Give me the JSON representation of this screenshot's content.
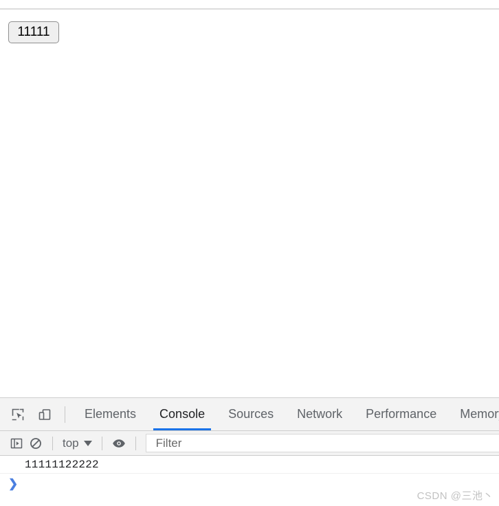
{
  "page": {
    "button_label": "11111"
  },
  "devtools": {
    "toolbar_icons": [
      {
        "name": "inspect-element-icon",
        "title": "Inspect element"
      },
      {
        "name": "device-toolbar-icon",
        "title": "Toggle device toolbar"
      }
    ],
    "tabs": [
      {
        "label": "Elements",
        "selected": false
      },
      {
        "label": "Console",
        "selected": true
      },
      {
        "label": "Sources",
        "selected": false
      },
      {
        "label": "Network",
        "selected": false
      },
      {
        "label": "Performance",
        "selected": false
      },
      {
        "label": "Memory",
        "selected": false
      }
    ],
    "filter_bar": {
      "sidebar_toggle_icon": "console-sidebar-icon",
      "clear_console_icon": "clear-console-icon",
      "context_label": "top",
      "eye_icon": "live-expression-eye-icon",
      "filter_placeholder": "Filter",
      "filter_value": ""
    },
    "console": {
      "messages": [
        {
          "text": "11111122222"
        }
      ],
      "prompt_symbol": "❯",
      "prompt_value": ""
    }
  },
  "watermark": {
    "text": "CSDN @三池丶"
  },
  "colors": {
    "accent_blue": "#1a73e8",
    "prompt_blue": "#4b7fe0",
    "toolbar_bg": "#f3f3f3",
    "border": "#cdcdcd",
    "button_bg": "#efefef",
    "button_border": "#8f8f8f",
    "watermark": "#c2c2c2"
  }
}
